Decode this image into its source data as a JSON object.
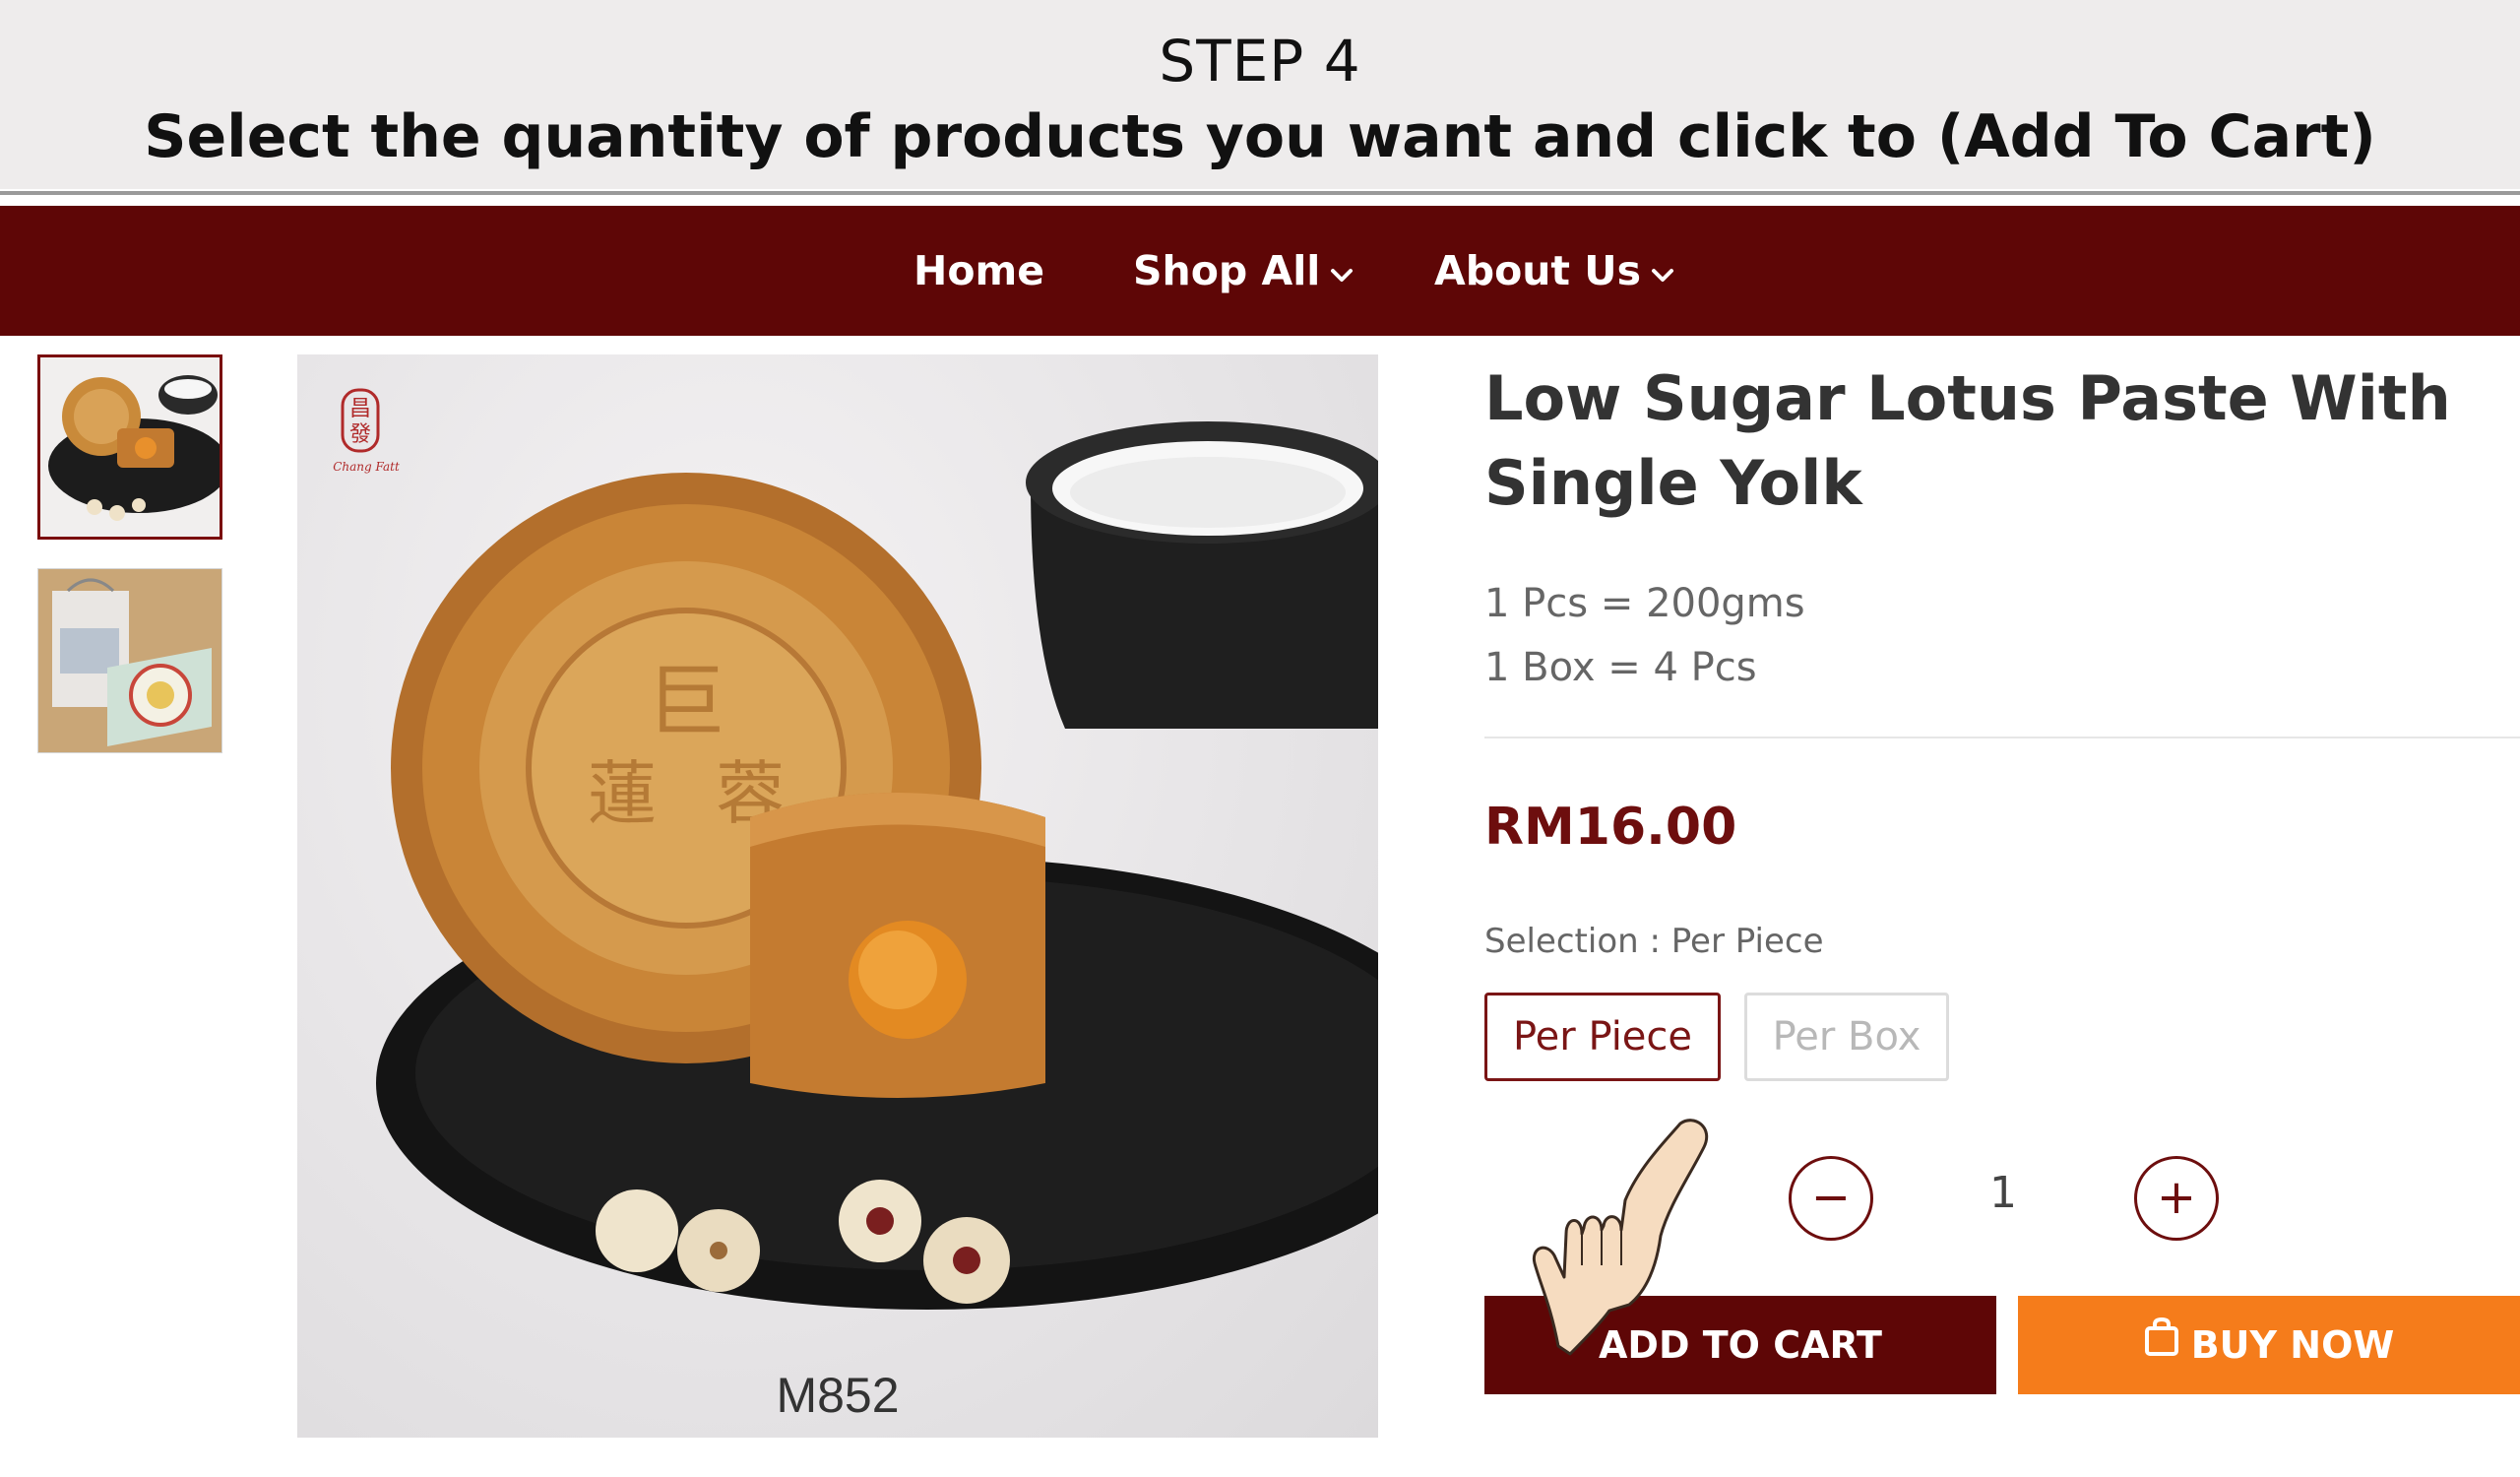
{
  "banner": {
    "step": "STEP 4",
    "instruction": "Select the quantity of products you want  and click to (Add To Cart)"
  },
  "nav": {
    "items": [
      {
        "label": "Home"
      },
      {
        "label": "Shop All"
      },
      {
        "label": "About Us"
      }
    ],
    "background_color": "#5e0606"
  },
  "gallery": {
    "thumbnails": [
      {
        "alt": "mooncake on plate"
      },
      {
        "alt": "gift box packaging"
      }
    ],
    "main_image_code": "M852"
  },
  "product": {
    "title": "Low Sugar Lotus Paste With Single Yolk",
    "specs": [
      "1 Pcs = 200gms",
      "1 Box = 4 Pcs"
    ],
    "price": "RM16.00",
    "selection_label": "Selection : Per Piece",
    "options": [
      {
        "label": "Per Piece",
        "selected": true
      },
      {
        "label": "Per Box",
        "selected": false
      }
    ],
    "quantity": "1",
    "minus_symbol": "−",
    "plus_symbol": "+",
    "add_to_cart": "ADD TO CART",
    "buy_now": "BUY NOW"
  },
  "colors": {
    "brand_maroon": "#5e0606",
    "price_red": "#6d0e0e",
    "buy_orange": "#f57c1b"
  }
}
